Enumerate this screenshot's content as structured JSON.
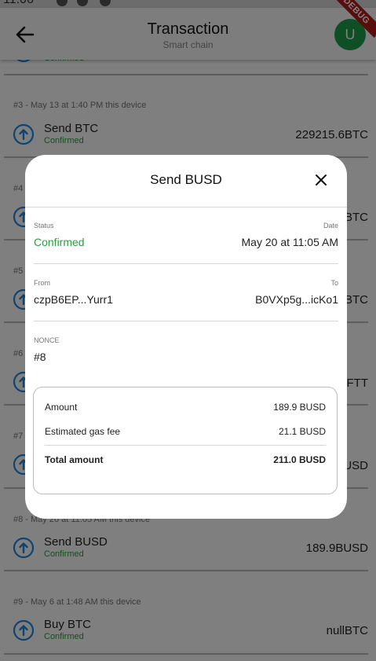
{
  "status_bar": {
    "time": "11:06"
  },
  "appbar": {
    "title": "Transaction",
    "subtitle": "Smart chain",
    "avatar_letter": "U",
    "debug_label": "DEBUG"
  },
  "transactions": [
    {
      "meta": "",
      "name": "",
      "status": "Confirmed",
      "amount": ""
    },
    {
      "meta": "#3 - May 13 at 1:40 PM this device",
      "name": "Send BTC",
      "status": "Confirmed",
      "amount": "229215.6BTC"
    },
    {
      "meta": "#4",
      "name": "",
      "status": "",
      "amount": "BTC"
    },
    {
      "meta": "#5",
      "name": "",
      "status": "",
      "amount": "BTC"
    },
    {
      "meta": "#6",
      "name": "",
      "status": "",
      "amount": "FTT"
    },
    {
      "meta": "#7",
      "name": "",
      "status": "",
      "amount": "USD"
    },
    {
      "meta": "#8 - May 20 at 11:05 AM this device",
      "name": "Send BUSD",
      "status": "Confirmed",
      "amount": "189.9BUSD"
    },
    {
      "meta": "#9 - May 6 at 1:48 AM this device",
      "name": "Buy BTC",
      "status": "Confirmed",
      "amount": "nullBTC"
    }
  ],
  "modal": {
    "title": "Send BUSD",
    "status_label": "Status",
    "status_value": "Confirmed",
    "date_label": "Date",
    "date_value": "May 20 at 11:05 AM",
    "from_label": "From",
    "from_value": "czpB6EP...Yurr1",
    "to_label": "To",
    "to_value": "B0VXp5g...icKo1",
    "nonce_label": "NONCE",
    "nonce_value": "#8",
    "amount_label": "Amount",
    "amount_value": "189.9 BUSD",
    "gas_label": "Estimated gas fee",
    "gas_value": "21.1 BUSD",
    "total_label": "Total amount",
    "total_value": "211.0 BUSD"
  },
  "colors": {
    "accent": "#1e88e5",
    "confirmed": "#2e9d3e",
    "avatar": "#1e9e4a",
    "debug_ribbon": "#b31b1b"
  },
  "icons": {
    "back": "arrow-left-icon",
    "tx_send": "arrow-up-circle-icon",
    "close": "close-icon"
  }
}
